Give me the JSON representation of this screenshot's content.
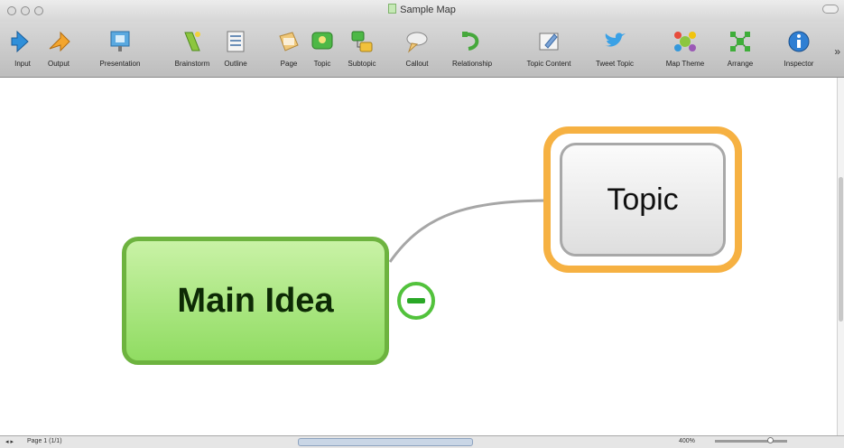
{
  "window": {
    "title": "Sample Map"
  },
  "toolbar": {
    "items": [
      {
        "label": "Input",
        "icon": "input-icon"
      },
      {
        "label": "Output",
        "icon": "output-icon"
      },
      {
        "label": "Presentation",
        "icon": "presentation-icon"
      },
      {
        "label": "Brainstorm",
        "icon": "brainstorm-icon"
      },
      {
        "label": "Outline",
        "icon": "outline-icon"
      },
      {
        "label": "Page",
        "icon": "page-icon"
      },
      {
        "label": "Topic",
        "icon": "topic-icon"
      },
      {
        "label": "Subtopic",
        "icon": "subtopic-icon"
      },
      {
        "label": "Callout",
        "icon": "callout-icon"
      },
      {
        "label": "Relationship",
        "icon": "relationship-icon"
      },
      {
        "label": "Topic Content",
        "icon": "topic-content-icon"
      },
      {
        "label": "Tweet Topic",
        "icon": "twitter-bird-icon"
      },
      {
        "label": "Map Theme",
        "icon": "map-theme-icon"
      },
      {
        "label": "Arrange",
        "icon": "arrange-icon"
      },
      {
        "label": "Inspector",
        "icon": "info-icon"
      }
    ],
    "overflow": "»"
  },
  "map": {
    "main_idea": "Main Idea",
    "topic": "Topic"
  },
  "statusbar": {
    "page": "Page 1 (1/1)",
    "zoom": "400%"
  },
  "colors": {
    "main_idea_border": "#6db33f",
    "main_idea_fill": "#90dc62",
    "selection": "#f6b142",
    "collapse": "#52c23c"
  }
}
